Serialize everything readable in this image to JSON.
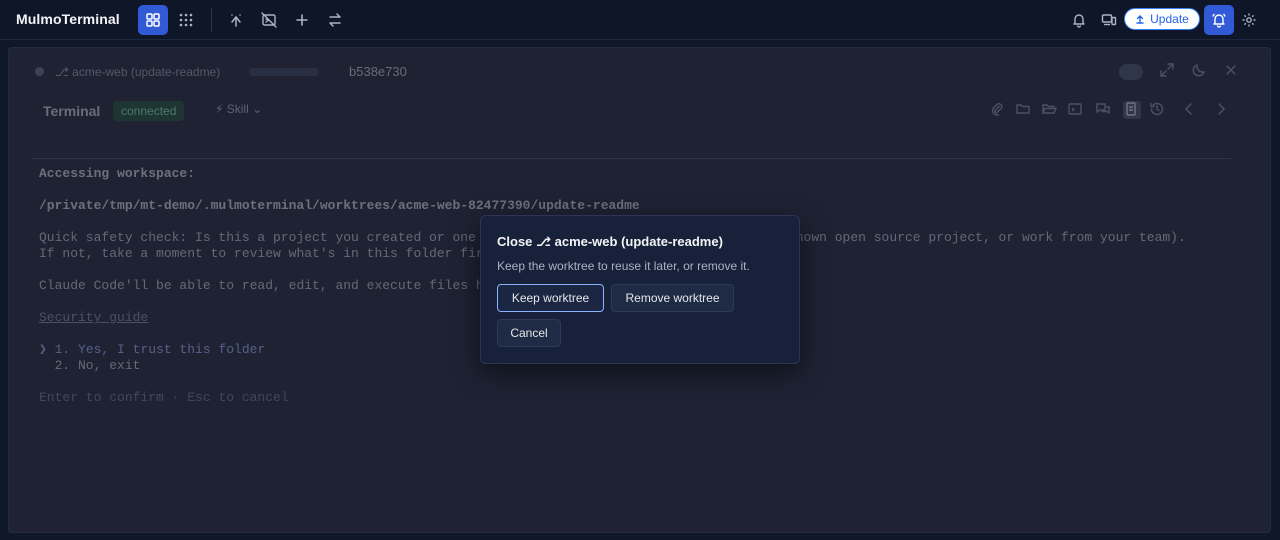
{
  "app": {
    "title": "MulmoTerminal"
  },
  "toolbar": {
    "update_label": "Update"
  },
  "panel": {
    "workspace_label": "⎇ acme-web (update-readme)",
    "commit": "b538e730",
    "terminal_title": "Terminal",
    "status": "connected",
    "skill_label": "⚡ Skill ⌄"
  },
  "terminal": {
    "lines": [
      "Accessing workspace:",
      "/private/tmp/mt-demo/.mulmoterminal/worktrees/acme-web-82477390/update-readme",
      "Quick safety check: Is this a project you created or one you trust? (Like your own code, a well-known open source project, or work from your team).",
      "If not, take a moment to review what's in this folder first.",
      "Claude Code'll be able to read, edit, and execute files here.",
      "Security guide",
      "❯ 1. Yes, I trust this folder",
      "  2. No, exit",
      "Enter to confirm · Esc to cancel"
    ]
  },
  "modal": {
    "title": "Close ⎇ acme-web (update-readme)",
    "description": "Keep the worktree to reuse it later, or remove it.",
    "keep_label": "Keep worktree",
    "remove_label": "Remove worktree",
    "cancel_label": "Cancel"
  },
  "colors": {
    "accent": "#3259d6",
    "connected": "#86efac",
    "primary_border": "#8ab4ff"
  }
}
